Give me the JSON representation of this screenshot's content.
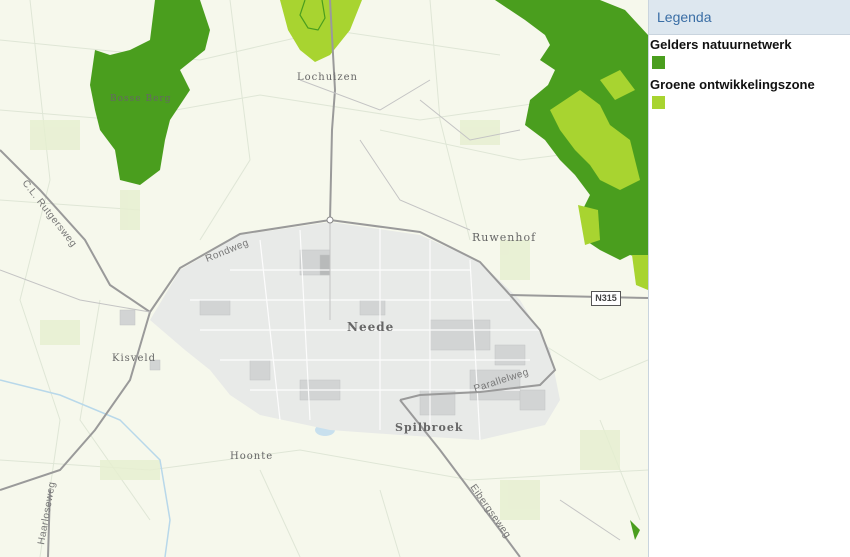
{
  "legend": {
    "title": "Legenda",
    "entries": [
      {
        "label": "Gelders natuurnetwerk",
        "color": "#4a9e1e"
      },
      {
        "label": "Groene ontwikkelingszone",
        "color": "#a8d430"
      }
    ]
  },
  "map": {
    "places": {
      "neede": "Neede",
      "lochuizen": "Lochuizen",
      "ruwenhof": "Ruwenhof",
      "kisveld": "Kisveld",
      "spilbroek": "Spilbroek",
      "hoonte": "Hoonte",
      "bosse_berg": "Bosse Berg"
    },
    "roads": {
      "rondweg": "Rondweg",
      "rutgersweg": "C.L. Rutgersweg",
      "parallelweg": "Parallelweg",
      "eibergseweg": "Eibergseweg",
      "haaksbergseweg": "Haarloseweg",
      "n315": "N315"
    }
  }
}
